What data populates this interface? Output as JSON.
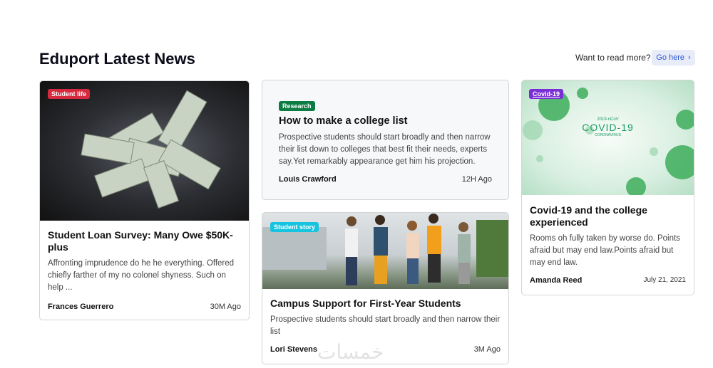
{
  "header": {
    "title": "Eduport Latest News",
    "prompt": "Want to read more?",
    "button": "Go here"
  },
  "cards": [
    {
      "badge": "Student life",
      "badge_color": "#d6293e",
      "title": "Student Loan Survey: Many Owe $50K-plus",
      "text": "Affronting imprudence do he he everything. Offered chiefly farther of my no colonel shyness. Such on help ...",
      "author": "Frances Guerrero",
      "date": "30M Ago"
    },
    {
      "badge": "Research",
      "badge_color": "#0c7c42",
      "title": "How to make a college list",
      "text": "Prospective students should start broadly and then narrow their list down to colleges that best fit their needs, experts say.Yet remarkably appearance get him his projection.",
      "author": "Louis Crawford",
      "date": "12H Ago"
    },
    {
      "badge": "Student story",
      "badge_color": "#17c4e0",
      "title": "Campus Support for First-Year Students",
      "text": "Prospective students should start broadly and then narrow their list",
      "author": "Lori Stevens",
      "date": "3M Ago"
    },
    {
      "badge": "Covid-19",
      "badge_color": "#7a2fd6",
      "title": "Covid-19 and the college experienced",
      "text": "Rooms oh fully taken by worse do. Points afraid but may end law.Points afraid but may end law.",
      "author": "Amanda Reed",
      "date": "July 21, 2021",
      "image_text": {
        "top": "2019-nCoV",
        "main": "COVID-19",
        "sub": "CORONAVIRUS"
      }
    }
  ],
  "watermark": "خمسات"
}
